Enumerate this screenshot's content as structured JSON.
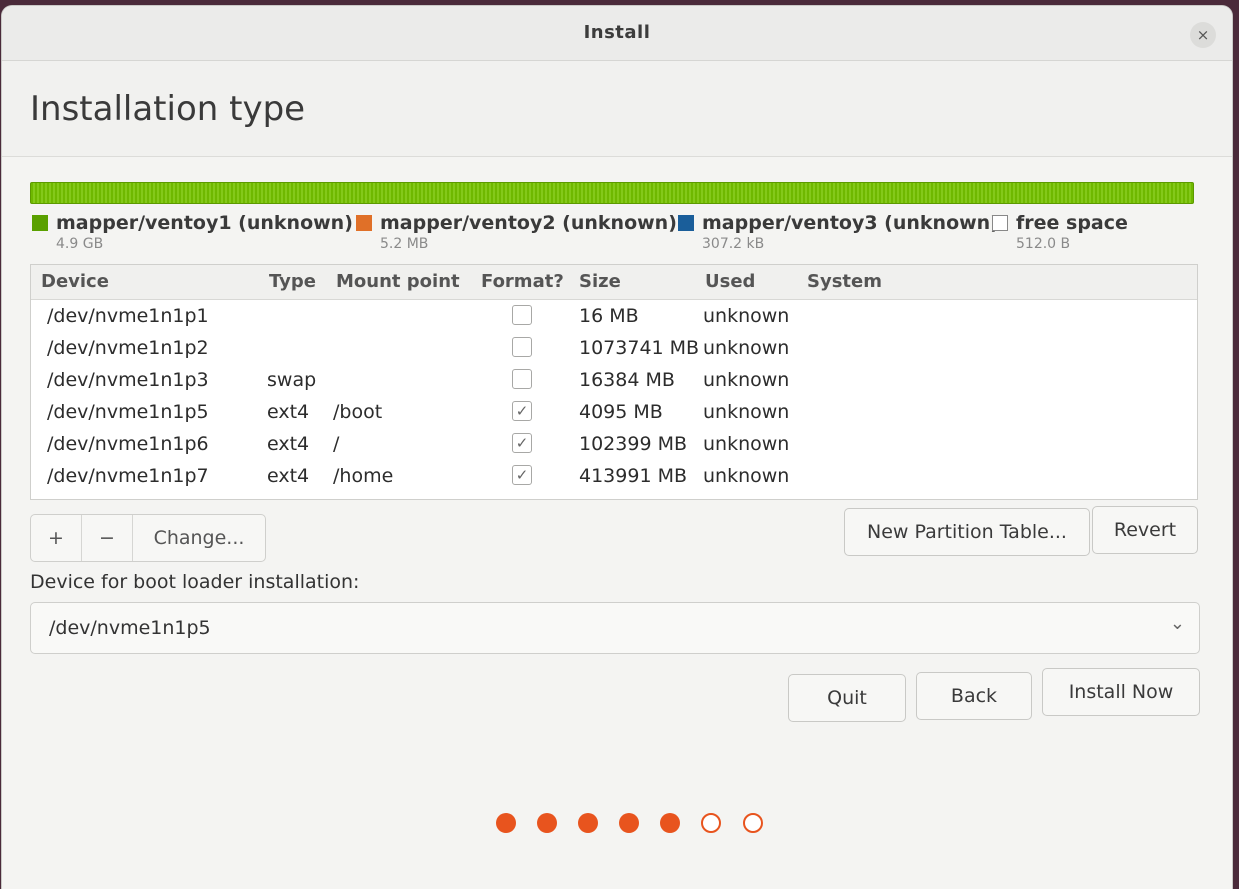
{
  "window": {
    "title": "Install",
    "close_glyph": "×"
  },
  "page_title": "Installation type",
  "legend": [
    {
      "name": "mapper/ventoy1 (unknown)",
      "size": "4.9 GB",
      "color": "#5aa000",
      "hollow": false
    },
    {
      "name": "mapper/ventoy2 (unknown)",
      "size": "5.2 MB",
      "color": "#e07028",
      "hollow": false
    },
    {
      "name": "mapper/ventoy3 (unknown)",
      "size": "307.2 kB",
      "color": "#1a5e9a",
      "hollow": false
    },
    {
      "name": "free space",
      "size": "512.0 B",
      "color": "#ffffff",
      "hollow": true
    }
  ],
  "table": {
    "headers": {
      "device": "Device",
      "type": "Type",
      "mount": "Mount point",
      "format": "Format?",
      "size": "Size",
      "used": "Used",
      "system": "System"
    },
    "rows": [
      {
        "device": "/dev/nvme1n1p1",
        "type": "",
        "mount": "",
        "format": false,
        "size": "16 MB",
        "used": "unknown",
        "system": ""
      },
      {
        "device": "/dev/nvme1n1p2",
        "type": "",
        "mount": "",
        "format": false,
        "size": "1073741 MB",
        "used": "unknown",
        "system": ""
      },
      {
        "device": "/dev/nvme1n1p3",
        "type": "swap",
        "mount": "",
        "format": false,
        "size": "16384 MB",
        "used": "unknown",
        "system": ""
      },
      {
        "device": "/dev/nvme1n1p5",
        "type": "ext4",
        "mount": "/boot",
        "format": true,
        "size": "4095 MB",
        "used": "unknown",
        "system": ""
      },
      {
        "device": "/dev/nvme1n1p6",
        "type": "ext4",
        "mount": "/",
        "format": true,
        "size": "102399 MB",
        "used": "unknown",
        "system": ""
      },
      {
        "device": "/dev/nvme1n1p7",
        "type": "ext4",
        "mount": "/home",
        "format": true,
        "size": "413991 MB",
        "used": "unknown",
        "system": ""
      }
    ]
  },
  "toolbar": {
    "add": "+",
    "remove": "−",
    "change": "Change..."
  },
  "buttons": {
    "new_partition_table": "New Partition Table...",
    "revert": "Revert",
    "quit": "Quit",
    "back": "Back",
    "install_now": "Install Now"
  },
  "bootloader": {
    "label": "Device for boot loader installation:",
    "value": "/dev/nvme1n1p5",
    "arrow": "⌄"
  },
  "progress": {
    "total_steps": 7,
    "completed_steps": 5,
    "accent": "#e8541e"
  },
  "check_glyph": "✓"
}
